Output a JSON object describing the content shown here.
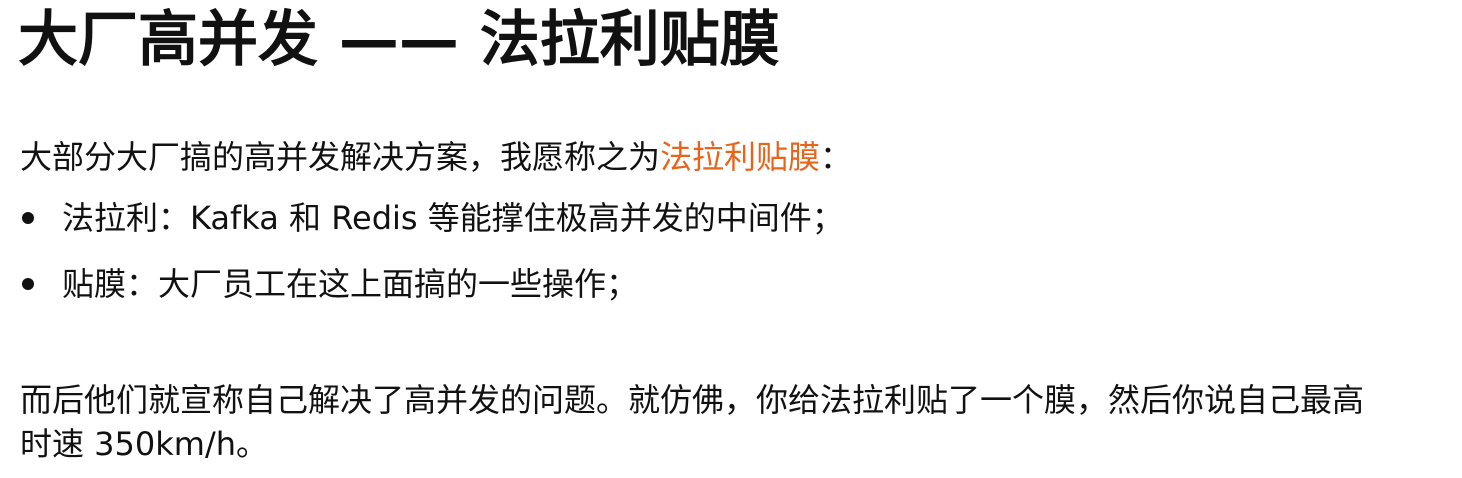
{
  "title": "大厂高并发 —— 法拉利贴膜",
  "intro": {
    "prefix": "大部分大厂搞的高并发解决方案，我愿称之为",
    "highlight": "法拉利贴膜",
    "suffix": "：",
    "highlight_color": "#e8641a"
  },
  "bullets": [
    {
      "text": "法拉利：Kafka 和 Redis 等能撑住极高并发的中间件；"
    },
    {
      "text": "贴膜：大厂员工在这上面搞的一些操作；"
    }
  ],
  "conclusion": {
    "line1": "而后他们就宣称自己解决了高并发的问题。就仿佛，你给法拉利贴了一个膜，然后你说自己最高",
    "line2": "时速 350km/h。"
  }
}
